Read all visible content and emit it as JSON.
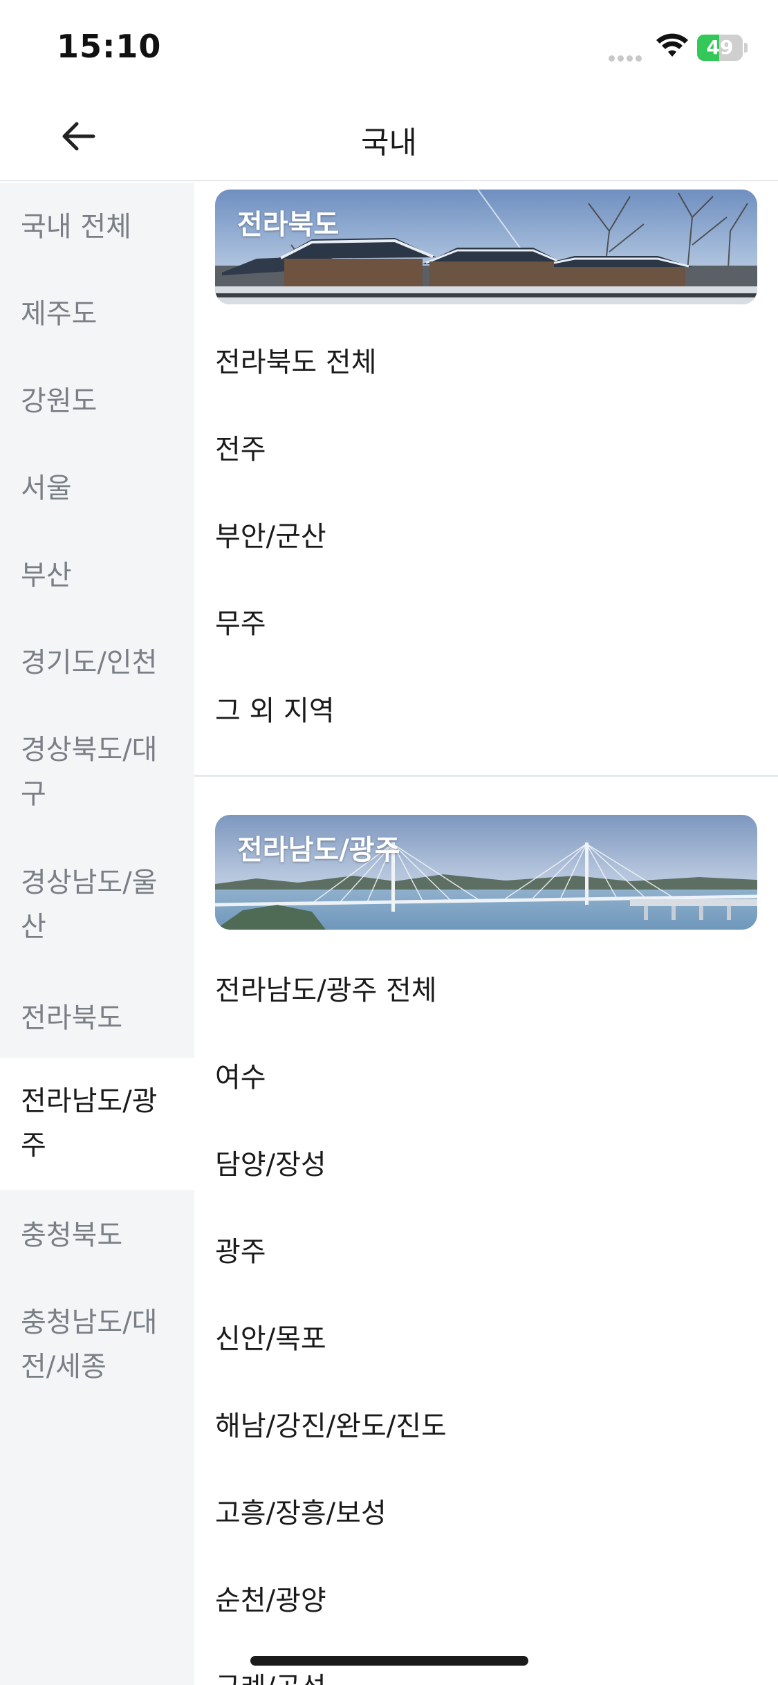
{
  "status_bar": {
    "time": "15:10",
    "battery_level": "49",
    "battery_fraction": 0.49,
    "battery_color": "#34c759"
  },
  "header": {
    "title": "국내",
    "back_icon": "arrow-left-icon"
  },
  "sidebar": {
    "active_index": 9,
    "items": [
      {
        "label": "국내 전체"
      },
      {
        "label": "제주도"
      },
      {
        "label": "강원도"
      },
      {
        "label": "서울"
      },
      {
        "label": "부산"
      },
      {
        "label": "경기도/인천"
      },
      {
        "label": "경상북도/대\n구"
      },
      {
        "label": "경상남도/울\n산"
      },
      {
        "label": "전라북도"
      },
      {
        "label": "전라남도/광\n주"
      },
      {
        "label": "충청북도"
      },
      {
        "label": "충청남도/대\n전/세종"
      }
    ]
  },
  "sections": [
    {
      "banner_title": "전라북도",
      "items": [
        "전라북도 전체",
        "전주",
        "부안/군산",
        "무주",
        "그 외 지역"
      ]
    },
    {
      "banner_title": "전라남도/광주",
      "items": [
        "전라남도/광주 전체",
        "여수",
        "담양/장성",
        "광주",
        "신안/목포",
        "해남/강진/완도/진도",
        "고흥/장흥/보성",
        "순천/광양",
        "구례/곡성"
      ]
    }
  ]
}
